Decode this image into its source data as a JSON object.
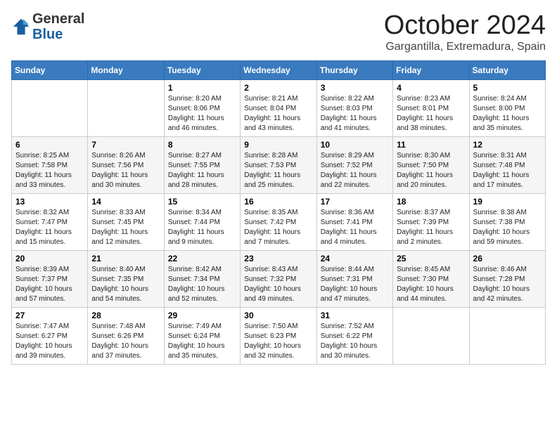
{
  "header": {
    "logo_general": "General",
    "logo_blue": "Blue",
    "month": "October 2024",
    "location": "Gargantilla, Extremadura, Spain"
  },
  "days_of_week": [
    "Sunday",
    "Monday",
    "Tuesday",
    "Wednesday",
    "Thursday",
    "Friday",
    "Saturday"
  ],
  "weeks": [
    [
      {
        "day": "",
        "content": ""
      },
      {
        "day": "",
        "content": ""
      },
      {
        "day": "1",
        "content": "Sunrise: 8:20 AM\nSunset: 8:06 PM\nDaylight: 11 hours and 46 minutes."
      },
      {
        "day": "2",
        "content": "Sunrise: 8:21 AM\nSunset: 8:04 PM\nDaylight: 11 hours and 43 minutes."
      },
      {
        "day": "3",
        "content": "Sunrise: 8:22 AM\nSunset: 8:03 PM\nDaylight: 11 hours and 41 minutes."
      },
      {
        "day": "4",
        "content": "Sunrise: 8:23 AM\nSunset: 8:01 PM\nDaylight: 11 hours and 38 minutes."
      },
      {
        "day": "5",
        "content": "Sunrise: 8:24 AM\nSunset: 8:00 PM\nDaylight: 11 hours and 35 minutes."
      }
    ],
    [
      {
        "day": "6",
        "content": "Sunrise: 8:25 AM\nSunset: 7:58 PM\nDaylight: 11 hours and 33 minutes."
      },
      {
        "day": "7",
        "content": "Sunrise: 8:26 AM\nSunset: 7:56 PM\nDaylight: 11 hours and 30 minutes."
      },
      {
        "day": "8",
        "content": "Sunrise: 8:27 AM\nSunset: 7:55 PM\nDaylight: 11 hours and 28 minutes."
      },
      {
        "day": "9",
        "content": "Sunrise: 8:28 AM\nSunset: 7:53 PM\nDaylight: 11 hours and 25 minutes."
      },
      {
        "day": "10",
        "content": "Sunrise: 8:29 AM\nSunset: 7:52 PM\nDaylight: 11 hours and 22 minutes."
      },
      {
        "day": "11",
        "content": "Sunrise: 8:30 AM\nSunset: 7:50 PM\nDaylight: 11 hours and 20 minutes."
      },
      {
        "day": "12",
        "content": "Sunrise: 8:31 AM\nSunset: 7:48 PM\nDaylight: 11 hours and 17 minutes."
      }
    ],
    [
      {
        "day": "13",
        "content": "Sunrise: 8:32 AM\nSunset: 7:47 PM\nDaylight: 11 hours and 15 minutes."
      },
      {
        "day": "14",
        "content": "Sunrise: 8:33 AM\nSunset: 7:45 PM\nDaylight: 11 hours and 12 minutes."
      },
      {
        "day": "15",
        "content": "Sunrise: 8:34 AM\nSunset: 7:44 PM\nDaylight: 11 hours and 9 minutes."
      },
      {
        "day": "16",
        "content": "Sunrise: 8:35 AM\nSunset: 7:42 PM\nDaylight: 11 hours and 7 minutes."
      },
      {
        "day": "17",
        "content": "Sunrise: 8:36 AM\nSunset: 7:41 PM\nDaylight: 11 hours and 4 minutes."
      },
      {
        "day": "18",
        "content": "Sunrise: 8:37 AM\nSunset: 7:39 PM\nDaylight: 11 hours and 2 minutes."
      },
      {
        "day": "19",
        "content": "Sunrise: 8:38 AM\nSunset: 7:38 PM\nDaylight: 10 hours and 59 minutes."
      }
    ],
    [
      {
        "day": "20",
        "content": "Sunrise: 8:39 AM\nSunset: 7:37 PM\nDaylight: 10 hours and 57 minutes."
      },
      {
        "day": "21",
        "content": "Sunrise: 8:40 AM\nSunset: 7:35 PM\nDaylight: 10 hours and 54 minutes."
      },
      {
        "day": "22",
        "content": "Sunrise: 8:42 AM\nSunset: 7:34 PM\nDaylight: 10 hours and 52 minutes."
      },
      {
        "day": "23",
        "content": "Sunrise: 8:43 AM\nSunset: 7:32 PM\nDaylight: 10 hours and 49 minutes."
      },
      {
        "day": "24",
        "content": "Sunrise: 8:44 AM\nSunset: 7:31 PM\nDaylight: 10 hours and 47 minutes."
      },
      {
        "day": "25",
        "content": "Sunrise: 8:45 AM\nSunset: 7:30 PM\nDaylight: 10 hours and 44 minutes."
      },
      {
        "day": "26",
        "content": "Sunrise: 8:46 AM\nSunset: 7:28 PM\nDaylight: 10 hours and 42 minutes."
      }
    ],
    [
      {
        "day": "27",
        "content": "Sunrise: 7:47 AM\nSunset: 6:27 PM\nDaylight: 10 hours and 39 minutes."
      },
      {
        "day": "28",
        "content": "Sunrise: 7:48 AM\nSunset: 6:26 PM\nDaylight: 10 hours and 37 minutes."
      },
      {
        "day": "29",
        "content": "Sunrise: 7:49 AM\nSunset: 6:24 PM\nDaylight: 10 hours and 35 minutes."
      },
      {
        "day": "30",
        "content": "Sunrise: 7:50 AM\nSunset: 6:23 PM\nDaylight: 10 hours and 32 minutes."
      },
      {
        "day": "31",
        "content": "Sunrise: 7:52 AM\nSunset: 6:22 PM\nDaylight: 10 hours and 30 minutes."
      },
      {
        "day": "",
        "content": ""
      },
      {
        "day": "",
        "content": ""
      }
    ]
  ]
}
